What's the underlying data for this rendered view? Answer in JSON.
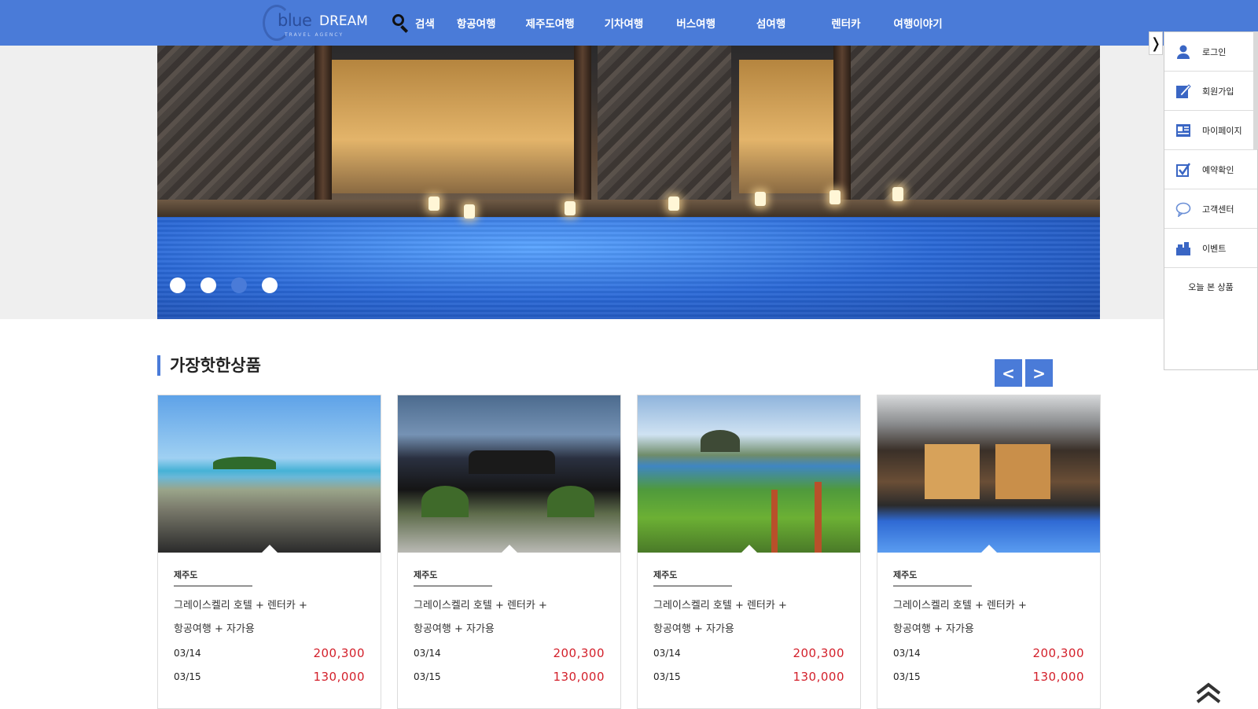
{
  "brand": {
    "name_blue": "blue",
    "name_dream": "DREAM",
    "tagline": "TRAVEL AGENCY"
  },
  "nav": {
    "search_label": "검색",
    "items": [
      "항공여행",
      "제주도여행",
      "기차여행",
      "버스여행",
      "섬여행",
      "렌터카",
      "여행이야기"
    ]
  },
  "hero": {
    "slide_count": 4,
    "active_slide": 3
  },
  "section": {
    "title": "가장핫한상품",
    "prev": "<",
    "next": ">"
  },
  "products": [
    {
      "region": "제주도",
      "desc_line1": "그레이스켈리 호텔 + 렌터카 +",
      "desc_line2": "항공여행 + 자가용",
      "date1": "03/14",
      "price1": "200,300",
      "date2": "03/15",
      "price2": "130,000",
      "image": "jeju-coast-island"
    },
    {
      "region": "제주도",
      "desc_line1": "그레이스켈리 호텔 + 렌터카 +",
      "desc_line2": "항공여행 + 자가용",
      "date1": "03/14",
      "price1": "200,300",
      "date2": "03/15",
      "price2": "130,000",
      "image": "kal-hotel-entrance"
    },
    {
      "region": "제주도",
      "desc_line1": "그레이스켈리 호텔 + 렌터카 +",
      "desc_line2": "항공여행 + 자가용",
      "date1": "03/14",
      "price1": "200,300",
      "date2": "03/15",
      "price2": "130,000",
      "image": "coastal-trail-sanbangsan"
    },
    {
      "region": "제주도",
      "desc_line1": "그레이스켈리 호텔 + 렌터카 +",
      "desc_line2": "항공여행 + 자가용",
      "date1": "03/14",
      "price1": "200,300",
      "date2": "03/15",
      "price2": "130,000",
      "image": "resort-pool-villa"
    }
  ],
  "quick_menu": {
    "toggle": "❭",
    "items": [
      {
        "label": "로그인",
        "icon": "user-icon"
      },
      {
        "label": "회원가입",
        "icon": "signup-icon"
      },
      {
        "label": "마이페이지",
        "icon": "mypage-icon"
      },
      {
        "label": "예약확인",
        "icon": "check-icon"
      },
      {
        "label": "고객센터",
        "icon": "chat-icon"
      },
      {
        "label": "이벤트",
        "icon": "gift-icon"
      }
    ],
    "recent_label": "오늘 본 상품"
  },
  "colors": {
    "accent": "#4a7bd8",
    "price": "#d31f2a",
    "header": "#4a7bd8"
  }
}
